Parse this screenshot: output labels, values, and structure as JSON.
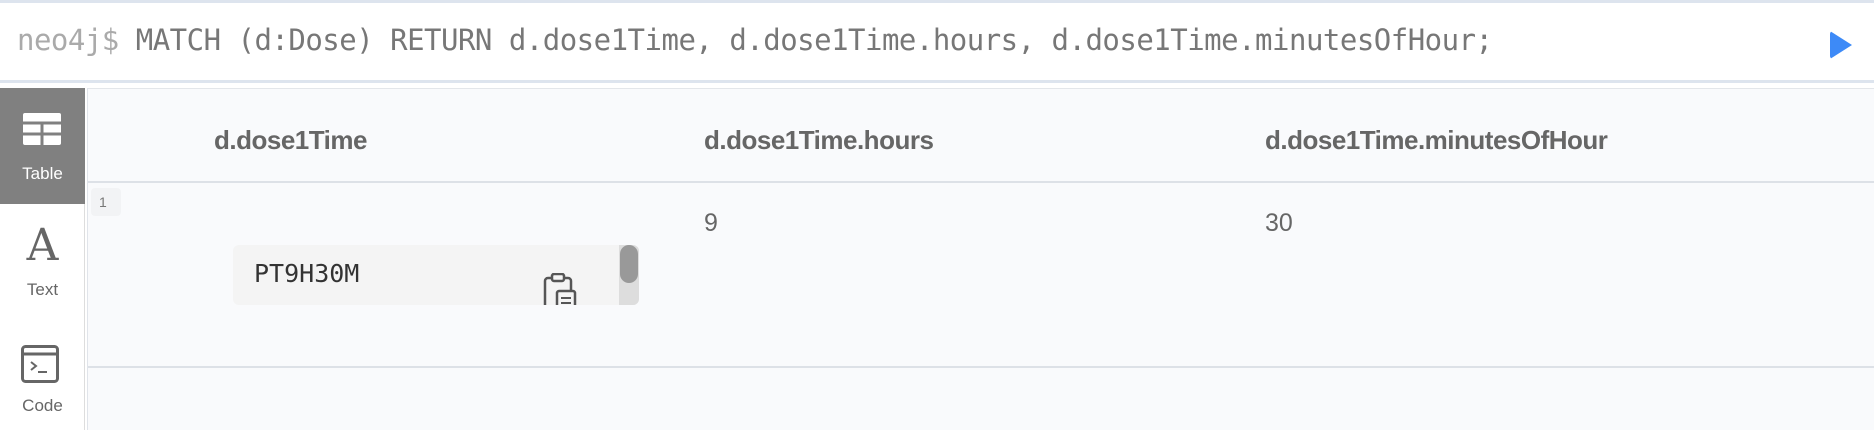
{
  "editor": {
    "prompt": "neo4j$",
    "query": "MATCH (d:Dose) RETURN d.dose1Time, d.dose1Time.hours, d.dose1Time.minutesOfHour;",
    "run_color": "#3d8af7"
  },
  "sidebar": {
    "items": [
      {
        "label": "Table",
        "icon": "table-icon",
        "active": true
      },
      {
        "label": "Text",
        "icon": "text-icon"
      },
      {
        "label": "Code",
        "icon": "code-icon"
      }
    ]
  },
  "table": {
    "columns": [
      "d.dose1Time",
      "d.dose1Time.hours",
      "d.dose1Time.minutesOfHour"
    ],
    "rows": [
      {
        "num": "1",
        "cells": [
          "PT9H30M",
          "9",
          "30"
        ]
      }
    ]
  }
}
